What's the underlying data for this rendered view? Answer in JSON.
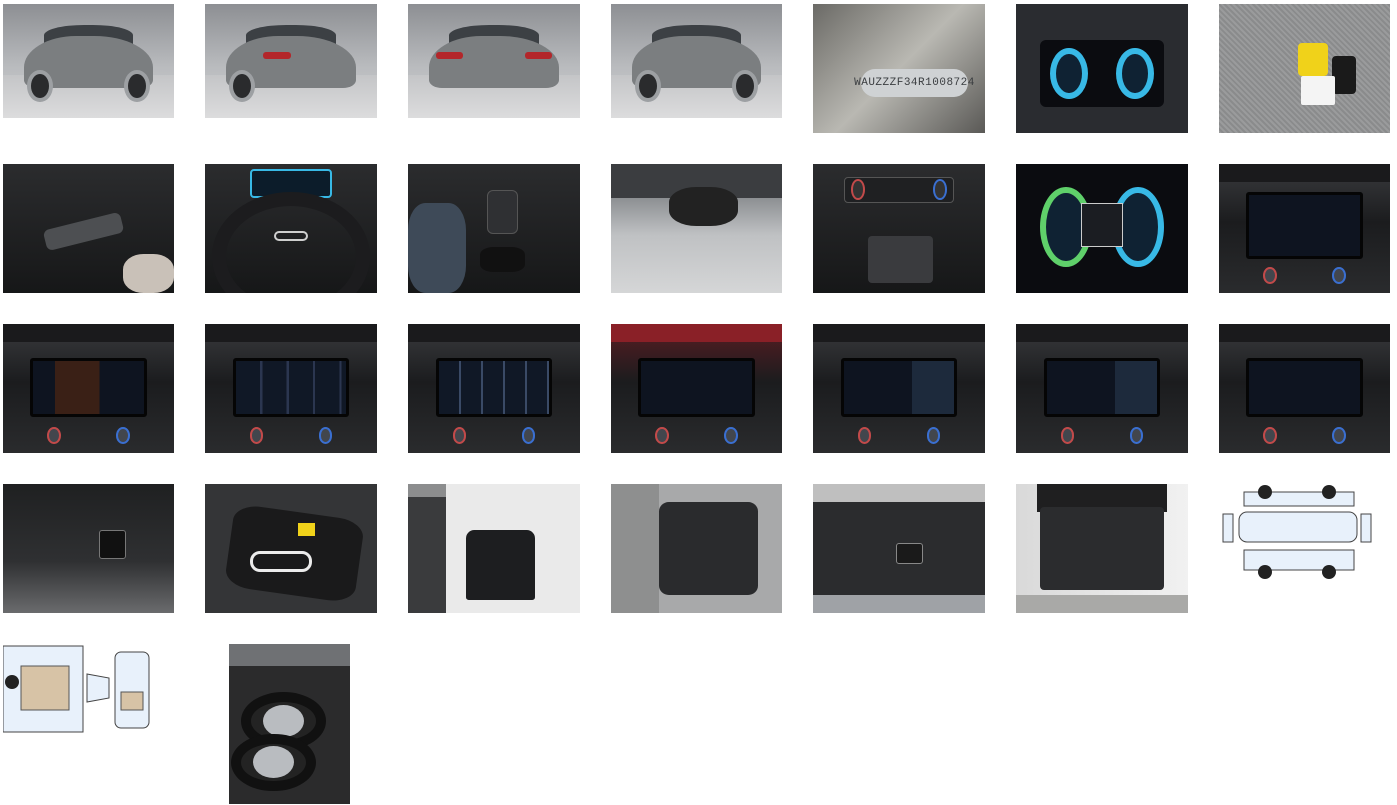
{
  "gallery": {
    "vin_plate_text": "WAUZZZF34R1008724",
    "photos": [
      {
        "icon": "car-front-left"
      },
      {
        "icon": "car-rear-left"
      },
      {
        "icon": "car-rear"
      },
      {
        "icon": "car-front-right"
      },
      {
        "icon": "vin-plate"
      },
      {
        "icon": "instrument-cluster"
      },
      {
        "icon": "key-tags"
      },
      {
        "icon": "stalk-controls"
      },
      {
        "icon": "steering-wheel"
      },
      {
        "icon": "gear-selector"
      },
      {
        "icon": "rear-view-mirror"
      },
      {
        "icon": "climate-controls"
      },
      {
        "icon": "instrument-cluster"
      },
      {
        "icon": "infotainment-screen"
      },
      {
        "icon": "infotainment-screen"
      },
      {
        "icon": "infotainment-screen"
      },
      {
        "icon": "infotainment-screen"
      },
      {
        "icon": "infotainment-screen"
      },
      {
        "icon": "infotainment-screen"
      },
      {
        "icon": "infotainment-screen"
      },
      {
        "icon": "infotainment-screen"
      },
      {
        "icon": "trunk-side-panel"
      },
      {
        "icon": "cable-bag"
      },
      {
        "icon": "front-door-open"
      },
      {
        "icon": "rear-door-open"
      },
      {
        "icon": "tailgate-buttons"
      },
      {
        "icon": "open-trunk"
      },
      {
        "icon": "damage-diagram-exterior"
      },
      {
        "icon": "damage-diagram-interior"
      },
      {
        "icon": "spare-wheels"
      }
    ]
  }
}
